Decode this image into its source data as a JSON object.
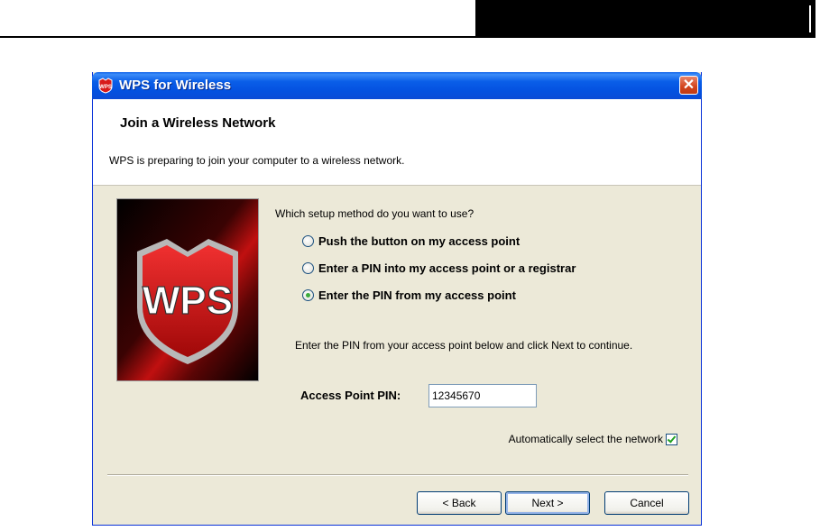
{
  "window": {
    "title": "WPS for Wireless",
    "close_glyph": "✕"
  },
  "header": {
    "title": "Join a Wireless Network",
    "subtitle": "WPS is preparing to join your computer to a wireless network."
  },
  "logo": {
    "text": "WPS",
    "colors": {
      "shield": "#d01818",
      "border": "#c0c0c0",
      "bg": "#000000"
    }
  },
  "form": {
    "question": "Which setup method do you want to use?",
    "options": [
      {
        "label": "Push the button on my access point",
        "selected": false
      },
      {
        "label": "Enter a PIN into my access point or a registrar",
        "selected": false
      },
      {
        "label": "Enter the PIN from my access point",
        "selected": true
      }
    ],
    "instruction": "Enter the PIN from your access point below and click Next to continue.",
    "pin_label": "Access Point PIN:",
    "pin_value": "12345670",
    "auto_select_label": "Automatically select the network",
    "auto_select_checked": true
  },
  "buttons": {
    "back": "< Back",
    "next": "Next >",
    "cancel": "Cancel"
  }
}
